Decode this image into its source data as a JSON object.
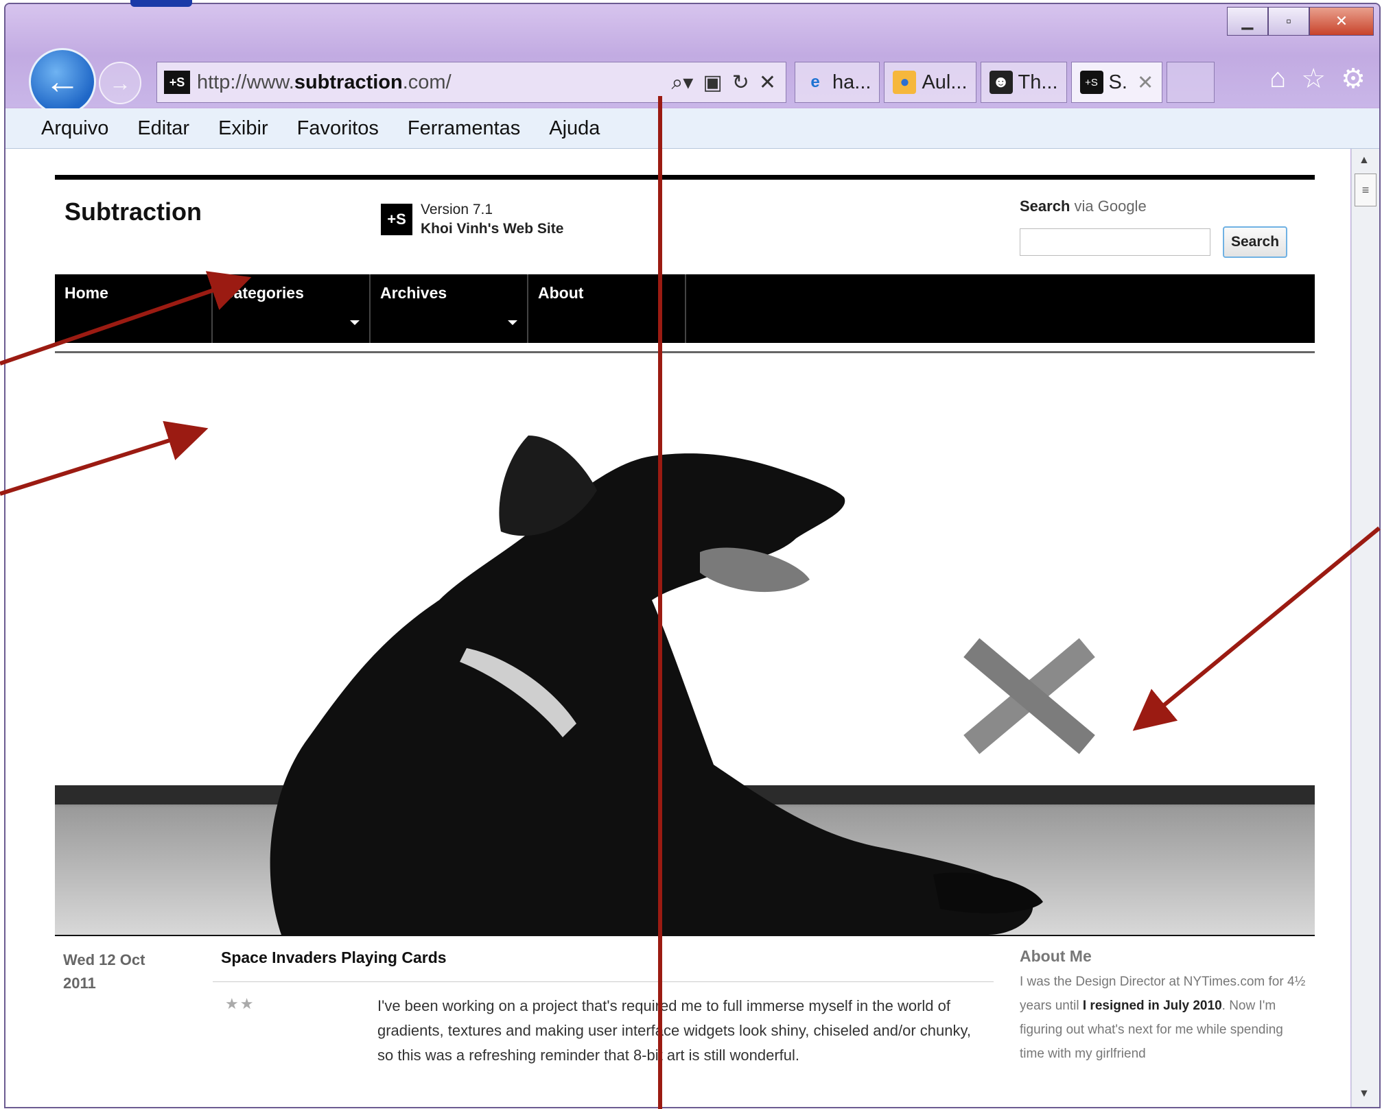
{
  "browser": {
    "window_controls": [
      "minimize",
      "maximize",
      "close"
    ],
    "address_url_prefix": "http://www.",
    "address_url_domain": "subtraction",
    "address_url_suffix": ".com/",
    "tabs": [
      {
        "label": "ha...",
        "icon": "ie-icon"
      },
      {
        "label": "Aul...",
        "icon": "people-icon"
      },
      {
        "label": "Th...",
        "icon": "mask-icon"
      },
      {
        "label": "S.",
        "icon": "subtraction-site-icon",
        "active": true
      }
    ],
    "menu": [
      "Arquivo",
      "Editar",
      "Exibir",
      "Favoritos",
      "Ferramentas",
      "Ajuda"
    ]
  },
  "site": {
    "logo": "Subtraction",
    "version": "Version 7.1",
    "tagline": "Khoi Vinh's Web Site",
    "search_label_bold": "Search",
    "search_label_rest": " via Google",
    "search_button": "Search",
    "nav": [
      {
        "label": "Home",
        "dropdown": false
      },
      {
        "label": "Categories",
        "dropdown": true
      },
      {
        "label": "Archives",
        "dropdown": true
      },
      {
        "label": "About",
        "dropdown": false
      }
    ],
    "post": {
      "date_line1": "Wed 12 Oct",
      "date_line2": "2011",
      "title": "Space Invaders Playing Cards",
      "rating": "★★",
      "body": "I've been working on a project that's required me to full immerse myself in the world of gradients, textures and making user interface widgets look shiny, chiseled and/or chunky, so this was a refreshing reminder that 8-bit art is still wonderful."
    },
    "aside": {
      "title": "About Me",
      "text1": "I was the Design Director at NYTimes.com for 4½ years until ",
      "bold1": "I resigned in July 2010",
      "text2": ". Now I'm figuring out what's next for me while spending time with my girlfriend"
    }
  },
  "colors": {
    "annotation": "#9b1b12",
    "nav_bg": "#000000",
    "window_frame": "#c9b6e8"
  }
}
